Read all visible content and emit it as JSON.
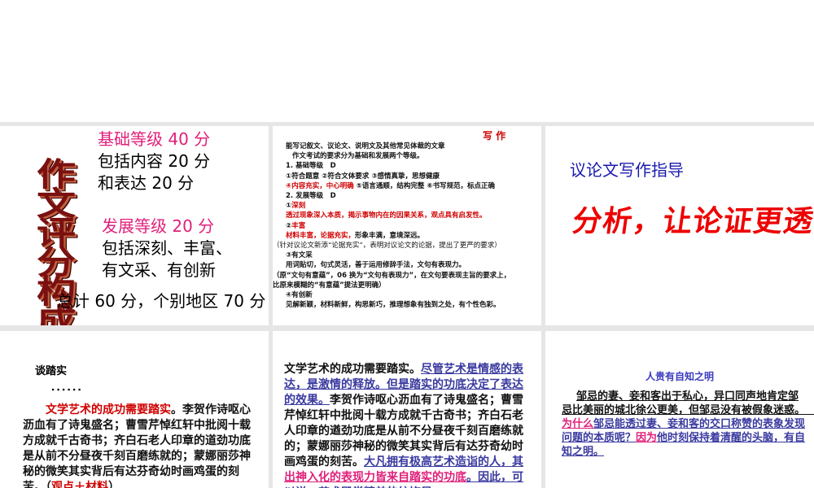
{
  "slide1": {
    "vertical_title": "作文评分构成",
    "basic": "基础等级 40 分",
    "basic_l1": "包括内容 20 分",
    "basic_l2": "和表达 20 分",
    "dev": "发展等级 20 分",
    "dev_l1": "包括深刻、丰富、",
    "dev_l2": "有文采、有创新",
    "total": "总计 60 分，个别地区 70 分"
  },
  "slide2": {
    "title": "写 作",
    "lines": [
      "能写记叙文、议论文、说明文及其他常见体裁的文章",
      "作文考试的要求分为基础和发展两个等级。",
      "1. 基础等级　D",
      "①符合题意 ②符合文体要求 ③感情真挚，思想健康"
    ],
    "l5_red": "④内容充实，中心明确",
    "l5_rest": " ⑤语言通顺，结构完整 ⑥书写规范，标点正确",
    "l6": "2. 发展等级　D",
    "l7a": "①",
    "l7b": "深刻",
    "l8": "透过现象深入本质，揭示事物内在的因果关系，观点具有启发性。",
    "l9a": "②",
    "l9b": "丰富",
    "l10_red": "材料丰富，论据充实，",
    "l10_rest": "形象丰满，意境深远。",
    "l11": "（针对议论文新添“论据充实”，表明对议论文的论据，提出了更严的要求）",
    "l12": "③有文采",
    "l13": "用词贴切，句式灵活，善于运用修辞手法，文句有表现力。",
    "l14": "（原“文句有意蕴”，06 换为“文句有表现力”，在文句要表现主旨的要求上，",
    "l15": "比原来模糊的“有意蕴”提法更明确）",
    "l16": "④有创新",
    "l17": "见解新颖，材料新鲜，构思新巧，推理想象有独到之处，有个性色彩。"
  },
  "slide3": {
    "subtitle": "议论文写作指导",
    "headline": "分析，让论证更透彻"
  },
  "slide4": {
    "title": "谈踏实",
    "dots": "．．．．．．",
    "red": "文学艺术的成功需要踏实",
    "rest": "。李贺作诗呕心沥血有了诗鬼盛名；曹雪芹悼红轩中批阅十载方成就千古奇书；齐白石老人印章的道劲功底是从前不分昼夜千刻百磨练就的；蒙娜丽莎神秘的微笑其实背后有达芬奇幼时画鸡蛋的刻苦。（",
    "note": "观点＋材料",
    "close": "）"
  },
  "slide5": {
    "p1": "文学艺术的成功需要踏实。",
    "p2": "尽管艺术是情感的表达，是激情的释放。但是踏实的功底决定了表达的效果。",
    "p3": "李贺作诗呕心沥血有了诗鬼盛名；曹雪芹悼红轩中批阅十载方成就千古奇书；齐白石老人印章的遒劲功底是从前不分昼夜千刻百磨练就的；蒙娜丽莎神秘的微笑其实背后有达芬奇幼时画鸡蛋的刻苦。",
    "p4": "大凡拥有极高艺术造诣的人，其",
    "p5": "出神入化的表现力皆来自踏实的功底",
    "p6": "。因此，可以说，艺术殿堂精美的纹饰是"
  },
  "slide6": {
    "title": "人贵有自知之明",
    "p1": "邹忌的妻、妾和客出于私心，异口同声地肯定邹忌比美丽的城北徐公更美，但邹忌没有被假象迷惑。",
    "gap": "　　　",
    "p2": "为什么",
    "p3": "邹忌能透过妻、妾和客的交口称赞的表象发现问题的本质呢？",
    "p4": "因为",
    "p5": "他时刻保持着清醒的头脑，有自知之明。"
  }
}
